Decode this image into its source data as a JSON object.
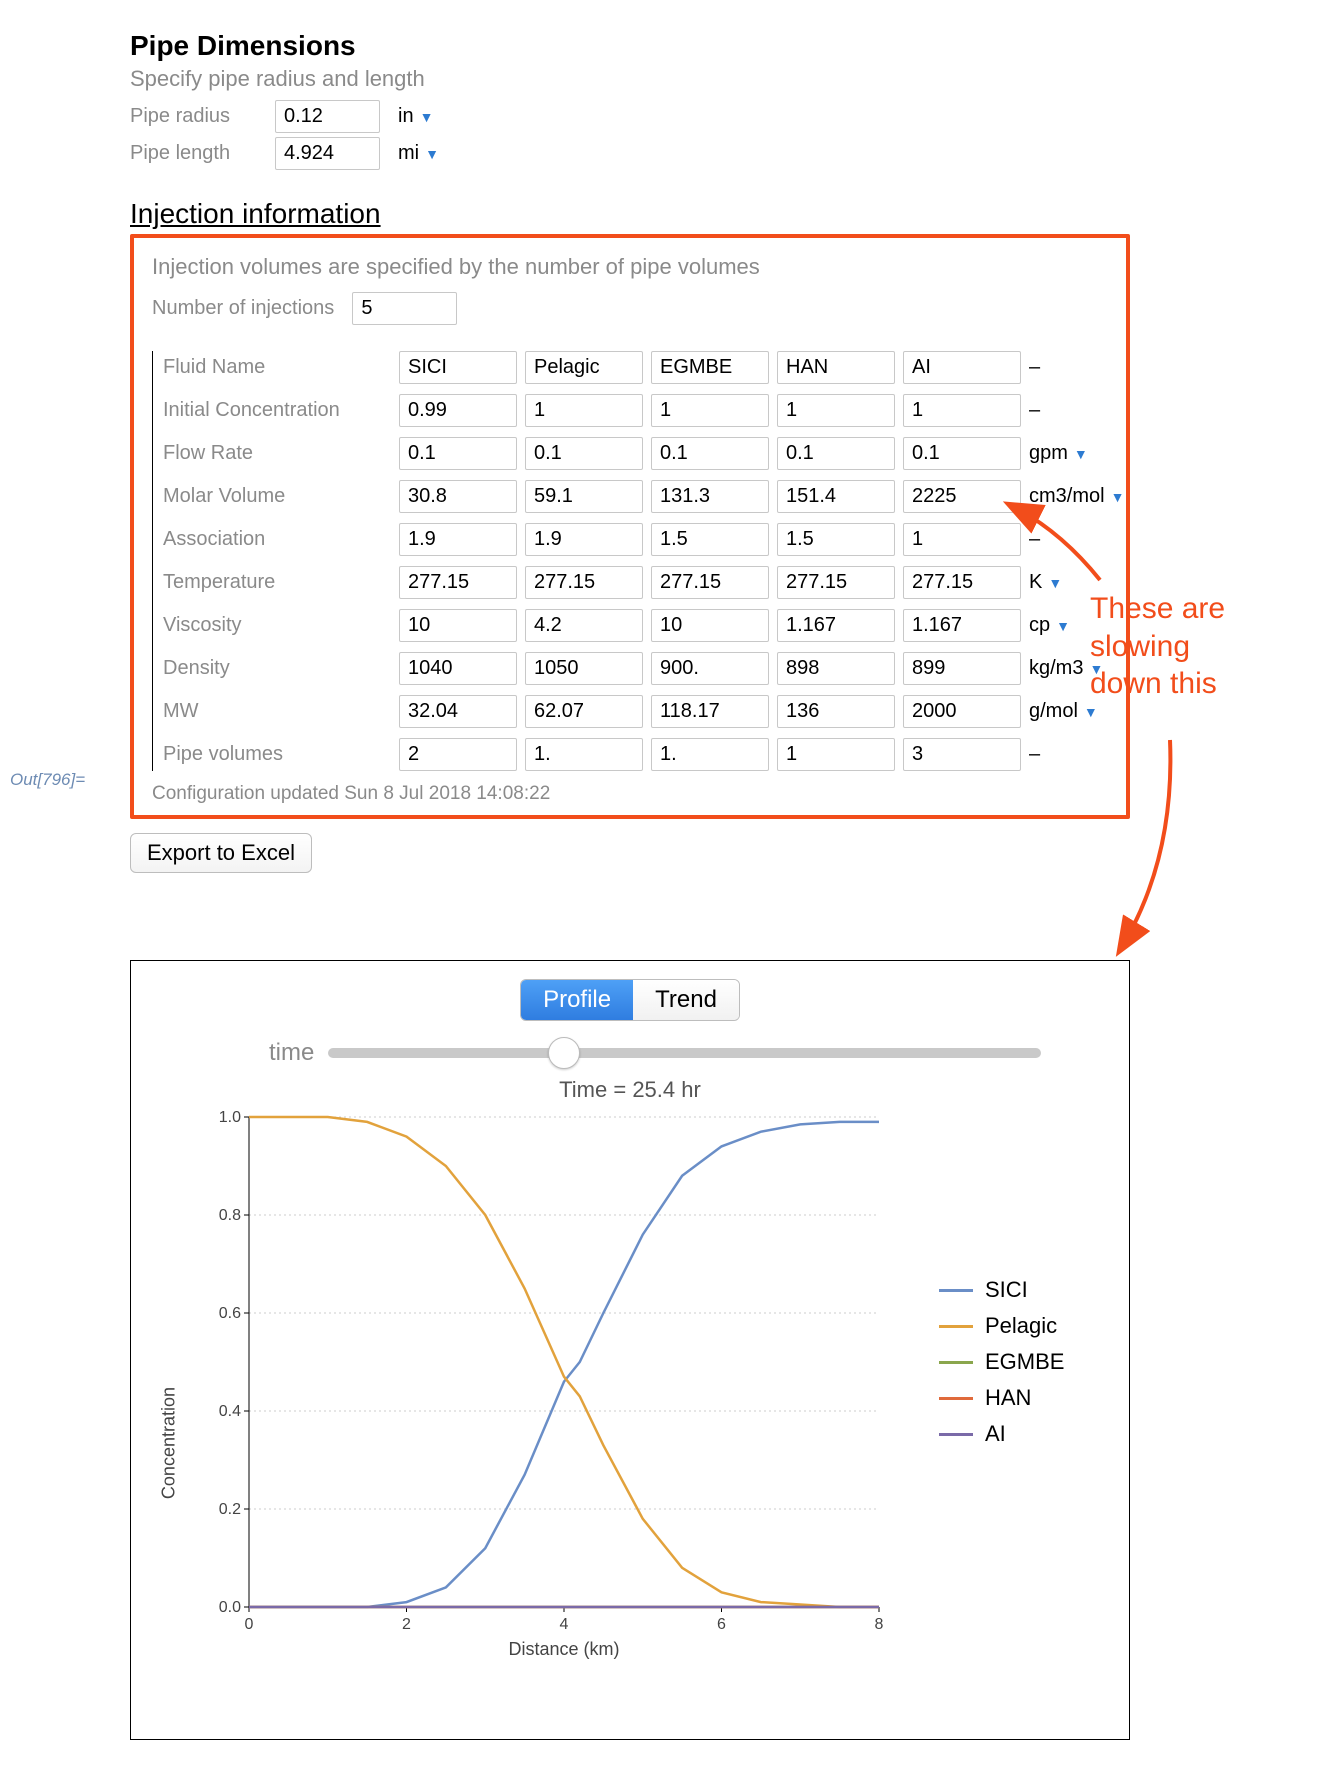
{
  "out_tag": "Out[796]=",
  "pipe": {
    "heading": "Pipe Dimensions",
    "sub": "Specify pipe radius and length",
    "radius_label": "Pipe radius",
    "radius_value": "0.12",
    "radius_unit": "in",
    "length_label": "Pipe length",
    "length_value": "4.924",
    "length_unit": "mi"
  },
  "injection": {
    "heading": "Injection information",
    "sub": "Injection volumes are specified by the number of pipe volumes",
    "num_label": "Number of injections",
    "num_value": "5",
    "rows": [
      {
        "label": "Fluid Name",
        "vals": [
          "SICI",
          "Pelagic",
          "EGMBE",
          "HAN",
          "AI"
        ],
        "unit": "–",
        "has_caret": false
      },
      {
        "label": "Initial Concentration",
        "vals": [
          "0.99",
          "1",
          "1",
          "1",
          "1"
        ],
        "unit": "–",
        "has_caret": false
      },
      {
        "label": "Flow Rate",
        "vals": [
          "0.1",
          "0.1",
          "0.1",
          "0.1",
          "0.1"
        ],
        "unit": "gpm",
        "has_caret": true
      },
      {
        "label": "Molar Volume",
        "vals": [
          "30.8",
          "59.1",
          "131.3",
          "151.4",
          "2225"
        ],
        "unit": "cm3/mol",
        "has_caret": true
      },
      {
        "label": "Association",
        "vals": [
          "1.9",
          "1.9",
          "1.5",
          "1.5",
          "1"
        ],
        "unit": "–",
        "has_caret": false
      },
      {
        "label": "Temperature",
        "vals": [
          "277.15",
          "277.15",
          "277.15",
          "277.15",
          "277.15"
        ],
        "unit": "K",
        "has_caret": true
      },
      {
        "label": "Viscosity",
        "vals": [
          "10",
          "4.2",
          "10",
          "1.167",
          "1.167"
        ],
        "unit": "cp",
        "has_caret": true
      },
      {
        "label": "Density",
        "vals": [
          "1040",
          "1050",
          "900.",
          "898",
          "899"
        ],
        "unit": "kg/m3",
        "has_caret": true
      },
      {
        "label": "MW",
        "vals": [
          "32.04",
          "62.07",
          "118.17",
          "136",
          "2000"
        ],
        "unit": "g/mol",
        "has_caret": true
      },
      {
        "label": "Pipe volumes",
        "vals": [
          "2",
          "1.",
          "1.",
          "1",
          "3"
        ],
        "unit": "–",
        "has_caret": false
      }
    ],
    "footer": "Configuration updated Sun 8 Jul 2018 14:08:22"
  },
  "export_label": "Export to Excel",
  "tabs": {
    "profile": "Profile",
    "trend": "Trend"
  },
  "slider": {
    "label": "time",
    "position_pct": 33
  },
  "annotation": "These are\nslowing\ndown this",
  "chart_data": {
    "type": "line",
    "title": "Time = 25.4 hr",
    "xlabel": "Distance (km)",
    "ylabel": "Concentration",
    "xlim": [
      0,
      8
    ],
    "ylim": [
      0,
      1.0
    ],
    "xticks": [
      0,
      2,
      4,
      6,
      8
    ],
    "yticks": [
      0.0,
      0.2,
      0.4,
      0.6,
      0.8,
      1.0
    ],
    "series": [
      {
        "name": "SICI",
        "color": "#6a8ec7",
        "x": [
          0,
          0.5,
          1.0,
          1.5,
          2.0,
          2.5,
          3.0,
          3.5,
          4.0,
          4.2,
          4.5,
          5.0,
          5.5,
          6.0,
          6.5,
          7.0,
          7.5,
          8.0
        ],
        "y": [
          0.0,
          0.0,
          0.0,
          0.0,
          0.01,
          0.04,
          0.12,
          0.27,
          0.46,
          0.5,
          0.6,
          0.76,
          0.88,
          0.94,
          0.97,
          0.985,
          0.99,
          0.99
        ]
      },
      {
        "name": "Pelagic",
        "color": "#e2a23c",
        "x": [
          0,
          0.5,
          1.0,
          1.5,
          2.0,
          2.5,
          3.0,
          3.5,
          4.0,
          4.2,
          4.5,
          5.0,
          5.5,
          6.0,
          6.5,
          7.0,
          7.5,
          8.0
        ],
        "y": [
          1.0,
          1.0,
          1.0,
          0.99,
          0.96,
          0.9,
          0.8,
          0.65,
          0.47,
          0.43,
          0.33,
          0.18,
          0.08,
          0.03,
          0.01,
          0.005,
          0.0,
          0.0
        ]
      },
      {
        "name": "EGMBE",
        "color": "#8aa64d",
        "x": [
          0,
          8
        ],
        "y": [
          0.0,
          0.0
        ]
      },
      {
        "name": "HAN",
        "color": "#e06a3b",
        "x": [
          0,
          8
        ],
        "y": [
          0.0,
          0.0
        ]
      },
      {
        "name": "AI",
        "color": "#7a6aa8",
        "x": [
          0,
          8
        ],
        "y": [
          0.0,
          0.0
        ]
      }
    ]
  }
}
